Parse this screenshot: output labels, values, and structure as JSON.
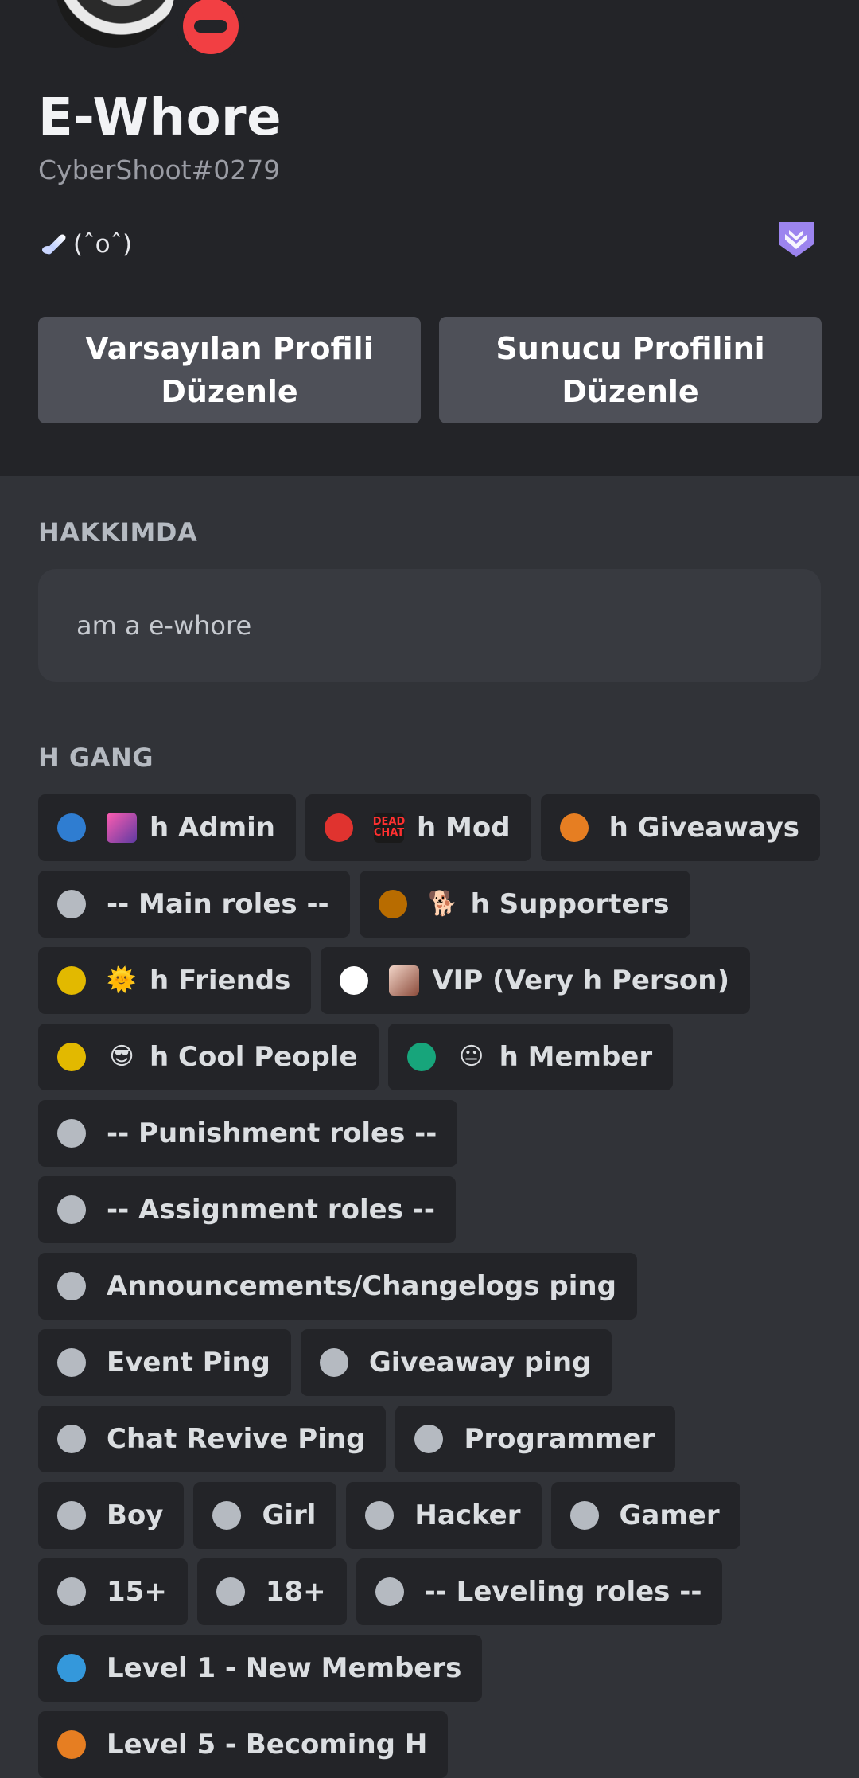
{
  "colors": {
    "header_bg": "#232428",
    "page_bg": "#313338",
    "button_bg": "#4e5058",
    "dnd_red": "#f23f43",
    "hypesquad_purple": "#9c84ef"
  },
  "profile": {
    "display_name": "E-Whore",
    "username": "CyberShoot#0279",
    "custom_status_text": "(ˆoˆ)",
    "status": "do-not-disturb"
  },
  "buttons": {
    "edit_default_profile": "Varsayılan Profili Düzenle",
    "edit_server_profile": "Sunucu Profilini Düzenle"
  },
  "about": {
    "title": "HAKKIMDA",
    "text": "am a e-whore"
  },
  "server": {
    "title": "H GANG"
  },
  "roles": [
    {
      "name": "h Admin",
      "color": "#2f7dd1",
      "icon": "purple-avatar-icon"
    },
    {
      "name": "h Mod",
      "color": "#e0332f",
      "icon": "dead-chat-icon"
    },
    {
      "name": "h Giveaways",
      "color": "#e67e22",
      "icon": ""
    },
    {
      "name": "-- Main roles --",
      "color": "#b5bac1",
      "icon": ""
    },
    {
      "name": "h Supporters",
      "color": "#b86c00",
      "icon": "doge-icon"
    },
    {
      "name": "h Friends",
      "color": "#e2b900",
      "icon": "sun-face-icon"
    },
    {
      "name": "VIP (Very h Person)",
      "color": "#ffffff",
      "icon": "person-photo-icon"
    },
    {
      "name": "h Cool People",
      "color": "#e2b900",
      "icon": "sunglasses-face-icon"
    },
    {
      "name": "h Member",
      "color": "#17a57b",
      "icon": "meme-face-icon"
    },
    {
      "name": "-- Punishment roles --",
      "color": "#b5bac1",
      "icon": ""
    },
    {
      "name": "-- Assignment roles --",
      "color": "#b5bac1",
      "icon": ""
    },
    {
      "name": "Announcements/Changelogs ping",
      "color": "#b5bac1",
      "icon": ""
    },
    {
      "name": "Event Ping",
      "color": "#b5bac1",
      "icon": ""
    },
    {
      "name": "Giveaway ping",
      "color": "#b5bac1",
      "icon": ""
    },
    {
      "name": "Chat Revive Ping",
      "color": "#b5bac1",
      "icon": ""
    },
    {
      "name": "Programmer",
      "color": "#b5bac1",
      "icon": ""
    },
    {
      "name": "Boy",
      "color": "#b5bac1",
      "icon": ""
    },
    {
      "name": "Girl",
      "color": "#b5bac1",
      "icon": ""
    },
    {
      "name": "Hacker",
      "color": "#b5bac1",
      "icon": ""
    },
    {
      "name": "Gamer",
      "color": "#b5bac1",
      "icon": ""
    },
    {
      "name": "15+",
      "color": "#b5bac1",
      "icon": ""
    },
    {
      "name": "18+",
      "color": "#b5bac1",
      "icon": ""
    },
    {
      "name": "-- Leveling roles --",
      "color": "#b5bac1",
      "icon": ""
    },
    {
      "name": "Level 1 - New Members",
      "color": "#3498db",
      "icon": ""
    },
    {
      "name": "Level 5 - Becoming H",
      "color": "#e67e22",
      "icon": ""
    }
  ]
}
